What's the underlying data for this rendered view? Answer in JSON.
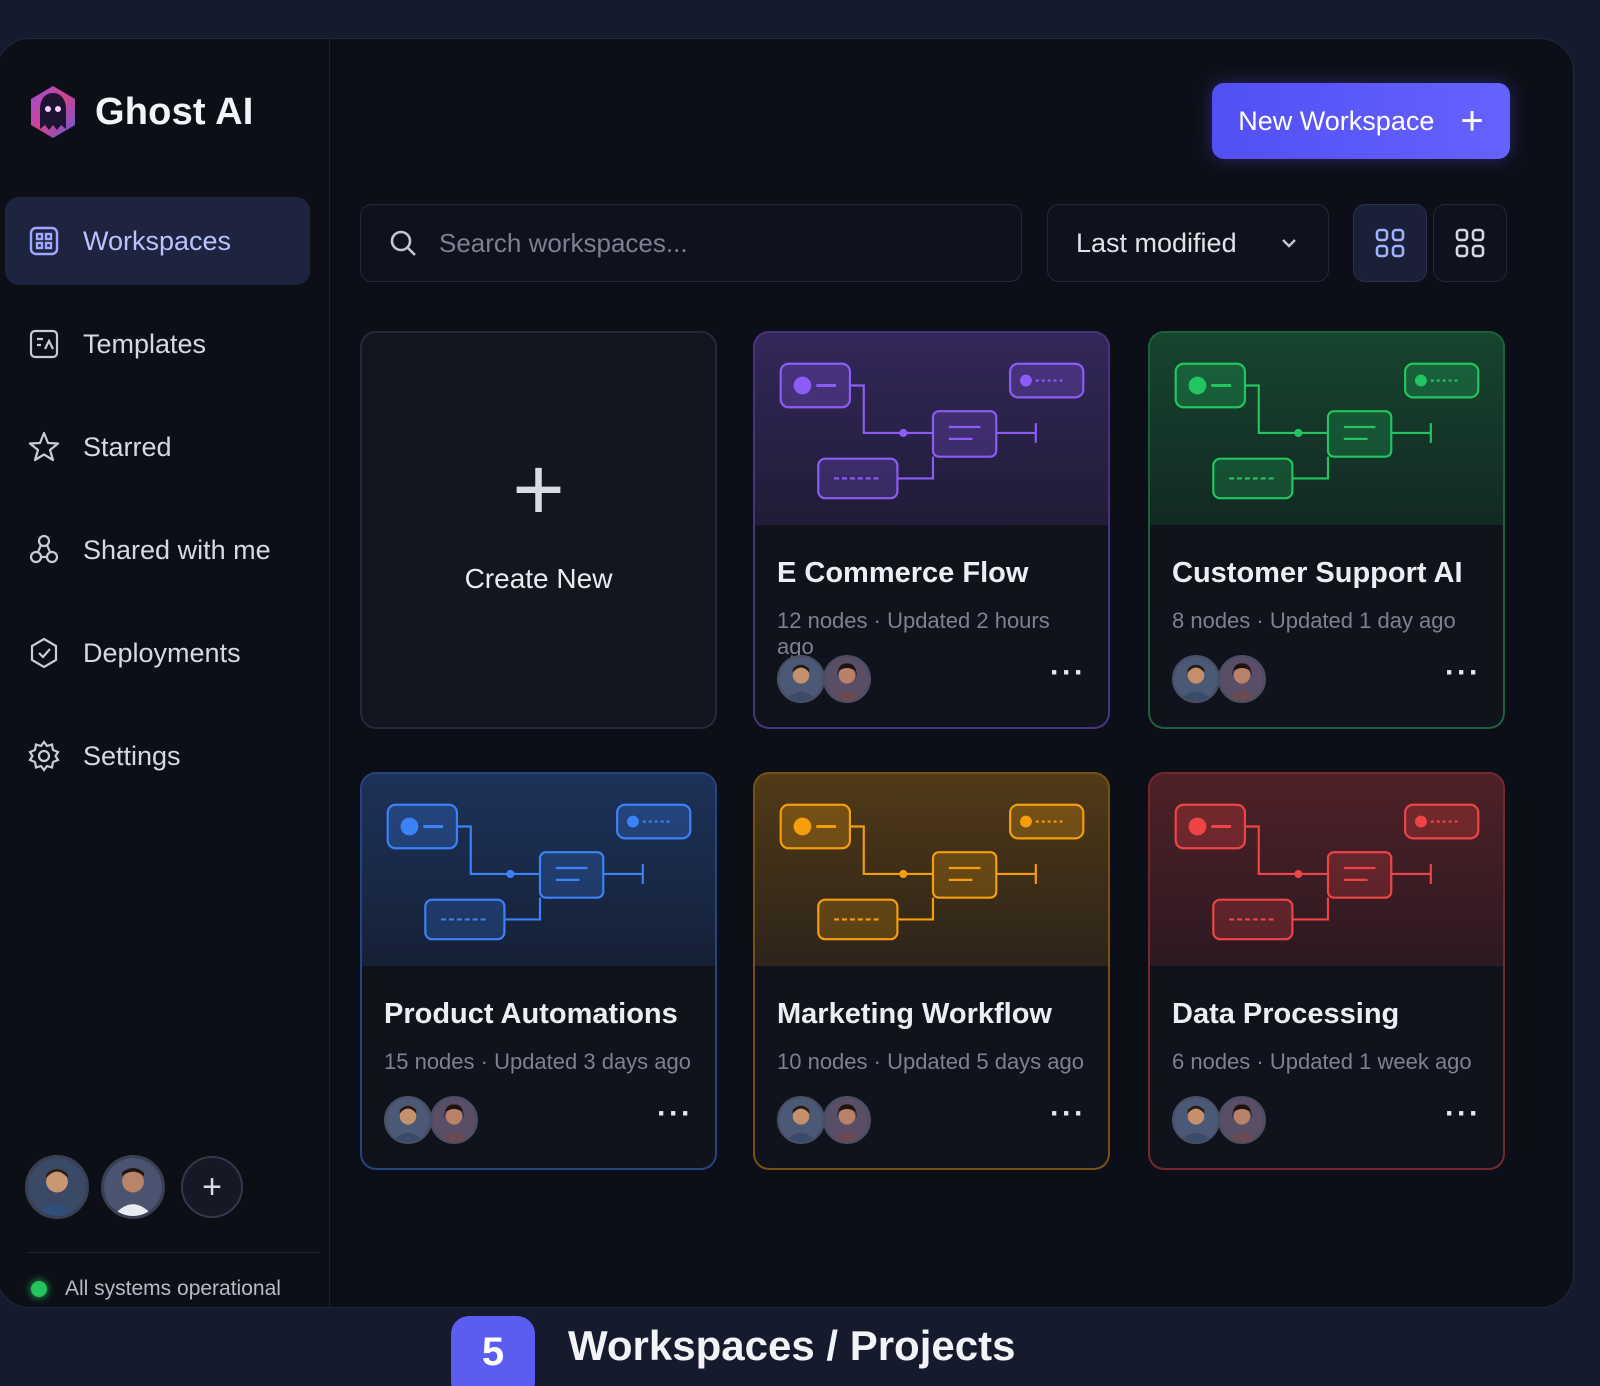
{
  "app": {
    "name": "Ghost AI"
  },
  "sidebar": {
    "items": [
      {
        "label": "Workspaces",
        "icon": "workspaces-icon",
        "active": true
      },
      {
        "label": "Templates",
        "icon": "templates-icon",
        "active": false
      },
      {
        "label": "Starred",
        "icon": "star-icon",
        "active": false
      },
      {
        "label": "Shared with me",
        "icon": "shared-icon",
        "active": false
      },
      {
        "label": "Deployments",
        "icon": "deployments-icon",
        "active": false
      },
      {
        "label": "Settings",
        "icon": "gear-icon",
        "active": false
      }
    ],
    "add_member_glyph": "+",
    "status_text": "All systems operational"
  },
  "header": {
    "new_workspace_label": "New Workspace",
    "new_workspace_glyph": "+"
  },
  "toolbar": {
    "search_placeholder": "Search workspaces...",
    "sort_value": "Last modified"
  },
  "create_card": {
    "glyph": "+",
    "label": "Create New"
  },
  "workspaces": [
    {
      "title": "E Commerce Flow",
      "meta": "12 nodes · Updated 2 hours ago",
      "accent": "#8b5cf6",
      "more": "···"
    },
    {
      "title": "Customer Support AI",
      "meta": "8 nodes · Updated 1 day ago",
      "accent": "#22c55e",
      "more": "···"
    },
    {
      "title": "Product Automations",
      "meta": "15 nodes · Updated 3 days ago",
      "accent": "#3b82f6",
      "more": "···"
    },
    {
      "title": "Marketing Workflow",
      "meta": "10 nodes · Updated 5 days ago",
      "accent": "#f59e0b",
      "more": "···"
    },
    {
      "title": "Data Processing",
      "meta": "6 nodes · Updated 1 week ago",
      "accent": "#ef4444",
      "more": "···"
    }
  ],
  "footer_caption": {
    "number": "5",
    "title": "Workspaces / Projects"
  },
  "colors": {
    "brand": "#5b5cf0",
    "background": "#0d0f18",
    "status_ok": "#22c55e"
  }
}
